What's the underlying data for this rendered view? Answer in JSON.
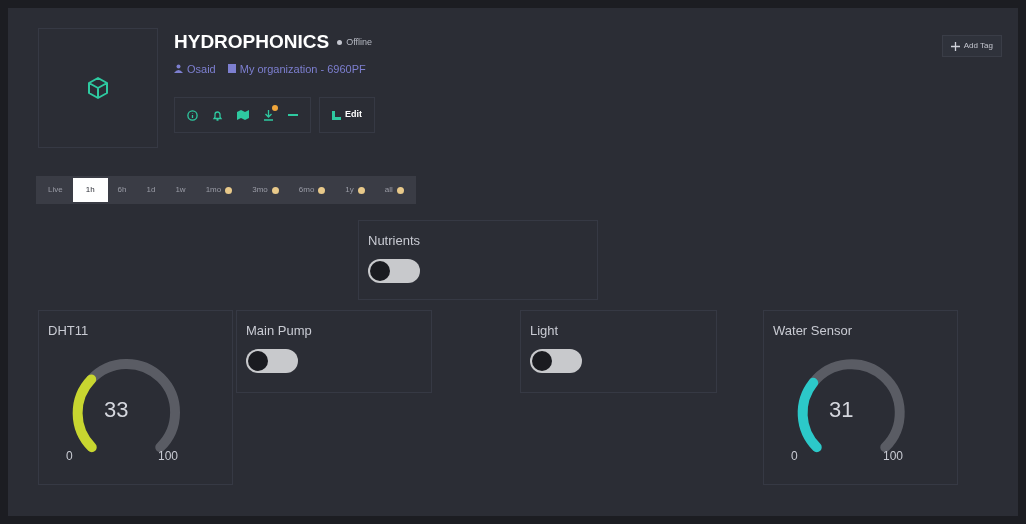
{
  "device": {
    "title": "HYDROPHONICS",
    "status": "Offline",
    "online": false,
    "owner": "Osaid",
    "organization": "My organization - 6960PF"
  },
  "actions": {
    "edit": "Edit",
    "add_tag": "Add Tag"
  },
  "time_ranges": [
    {
      "label": "Live",
      "selected": false,
      "badge": false
    },
    {
      "label": "1h",
      "selected": true,
      "badge": false
    },
    {
      "label": "6h",
      "selected": false,
      "badge": false
    },
    {
      "label": "1d",
      "selected": false,
      "badge": false
    },
    {
      "label": "1w",
      "selected": false,
      "badge": false
    },
    {
      "label": "1mo",
      "selected": false,
      "badge": true
    },
    {
      "label": "3mo",
      "selected": false,
      "badge": true
    },
    {
      "label": "6mo",
      "selected": false,
      "badge": true
    },
    {
      "label": "1y",
      "selected": false,
      "badge": true
    },
    {
      "label": "all",
      "selected": false,
      "badge": true
    }
  ],
  "widgets": [
    {
      "kind": "switch",
      "title": "Nutrients",
      "on": false
    },
    {
      "kind": "gauge",
      "title": "DHT11",
      "value": "33",
      "min": "0",
      "max": "100",
      "color": "#c8d630"
    },
    {
      "kind": "switch",
      "title": "Main Pump",
      "on": false
    },
    {
      "kind": "switch",
      "title": "Light",
      "on": false
    },
    {
      "kind": "gauge",
      "title": "Water Sensor",
      "value": "31",
      "min": "0",
      "max": "100",
      "color": "#2cc9c9"
    }
  ]
}
